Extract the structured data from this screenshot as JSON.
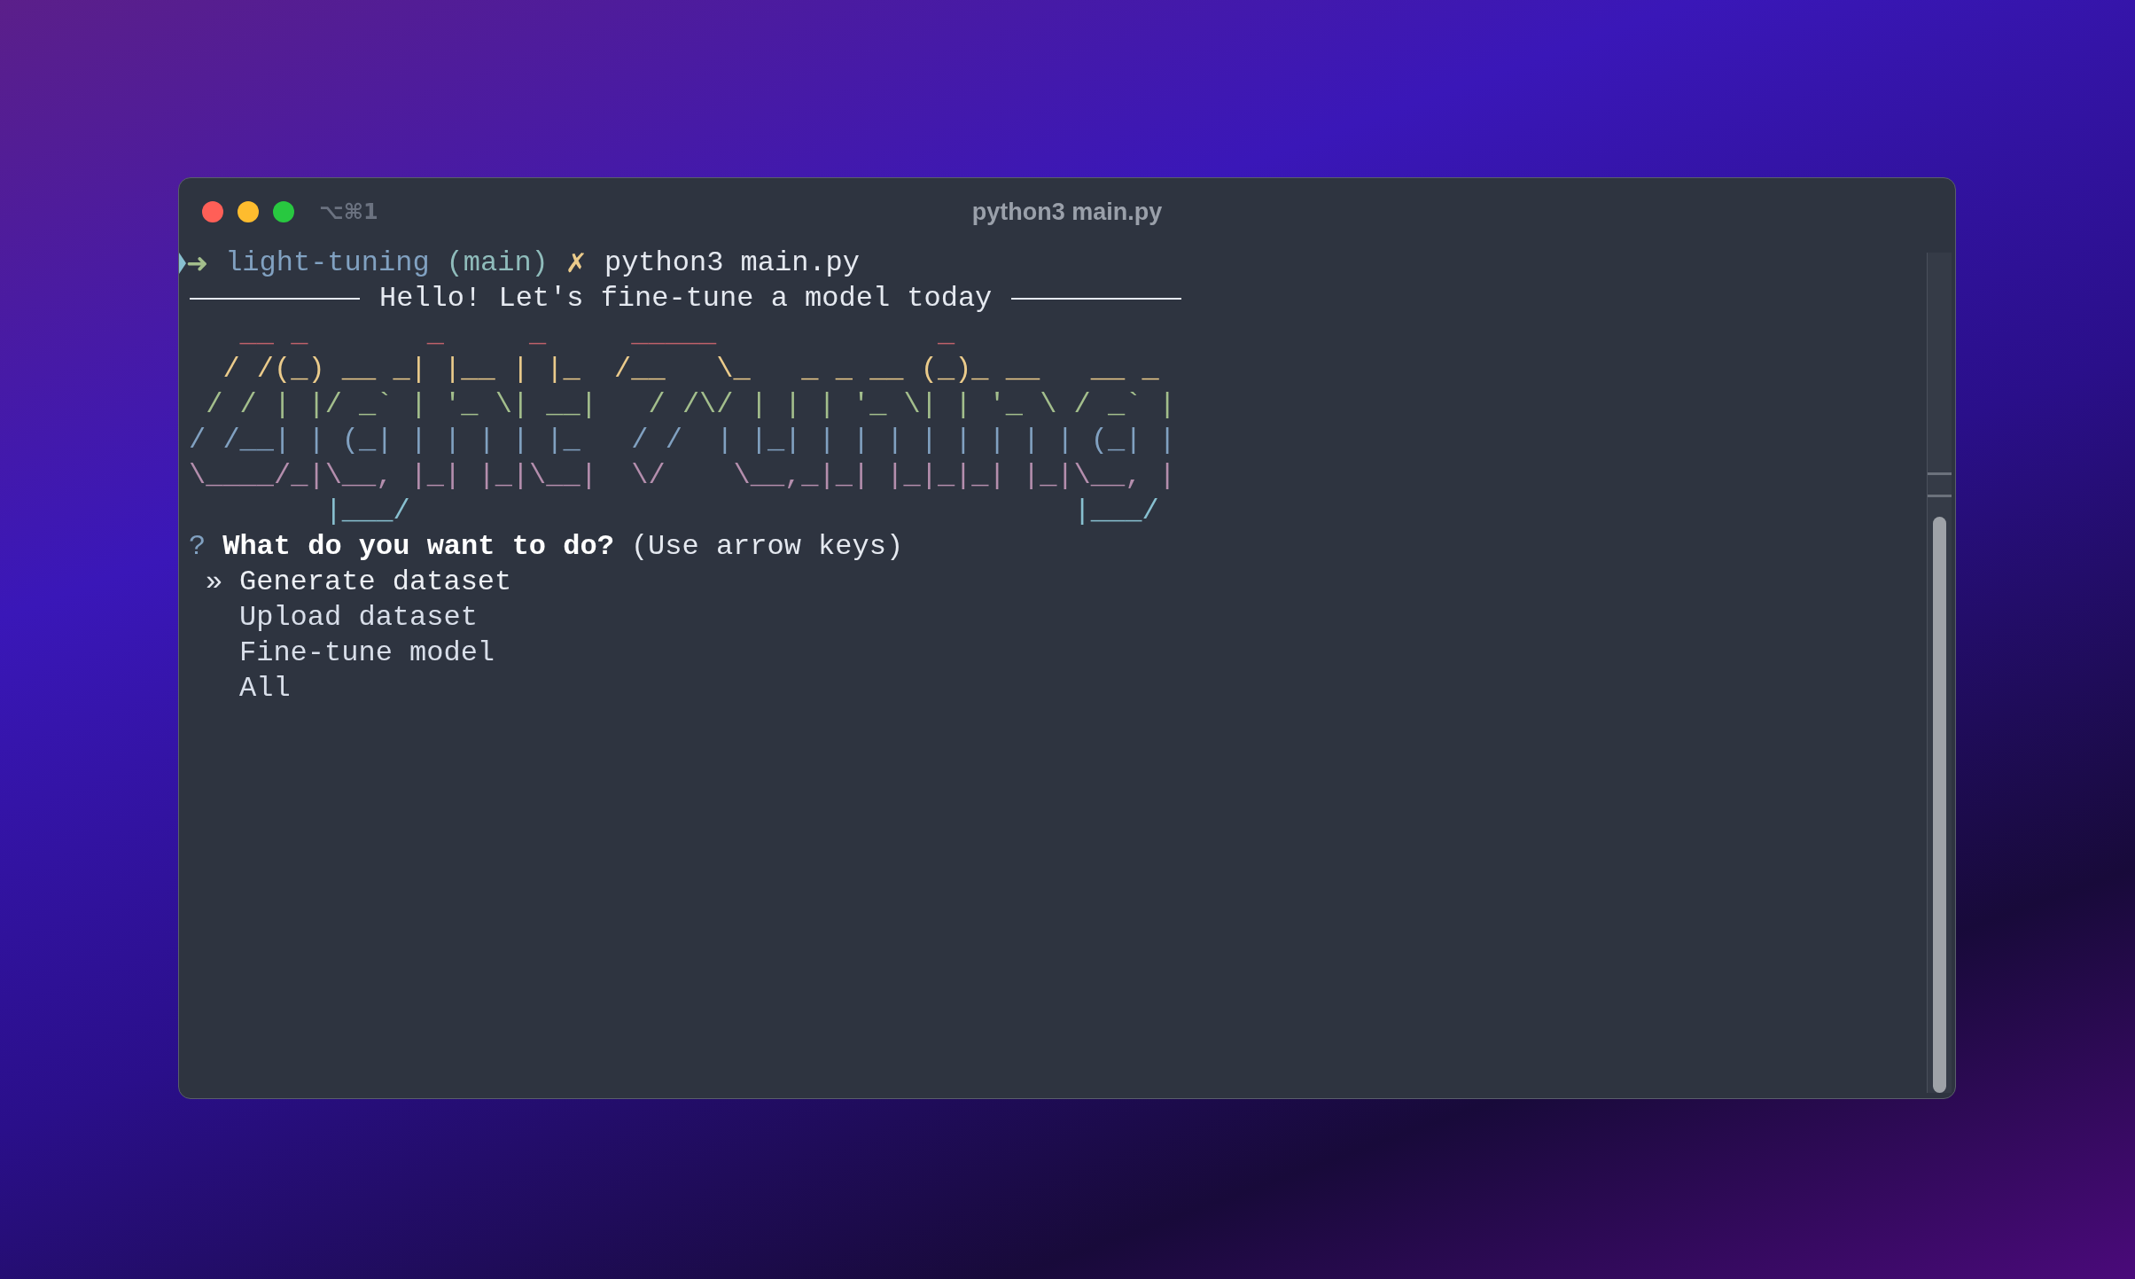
{
  "window": {
    "shortcut": "⌥⌘1",
    "title": "python3 main.py"
  },
  "prompt": {
    "arrow": "➜",
    "directory": "light-tuning",
    "branch": "(main)",
    "dirty_mark": "✗",
    "command": "python3 main.py"
  },
  "banner": {
    "text": "Hello! Let's fine-tune a model today"
  },
  "ascii_art": [
    {
      "text": "   __ _       _     _     _____             _",
      "color": "#bf616a"
    },
    {
      "text": "  / /(_) __ _| |__ | |_  /__   \\_   _ _ __ (_)_ __   __ _",
      "color": "#ebcb8b"
    },
    {
      "text": " / / | |/ _` | '_ \\| __|   / /\\/ | | | '_ \\| | '_ \\ / _` |",
      "color": "#a3be8c"
    },
    {
      "text": "/ /__| | (_| | | | | |_   / /  | |_| | | | | | | | | (_| |",
      "color": "#81a1c1"
    },
    {
      "text": "\\____/_|\\__, |_| |_|\\__|  \\/    \\__,_|_| |_|_|_| |_|\\__, |",
      "color": "#b48ead"
    },
    {
      "text": "        |___/                                       |___/",
      "color": "#88c0d0"
    }
  ],
  "question": {
    "mark": "?",
    "text": "What do you want to do?",
    "hint": "(Use arrow keys)"
  },
  "choices": {
    "pointer": "»",
    "items": [
      {
        "label": "Generate dataset",
        "selected": true
      },
      {
        "label": "Upload dataset",
        "selected": false
      },
      {
        "label": "Fine-tune model",
        "selected": false
      },
      {
        "label": "All",
        "selected": false
      }
    ]
  }
}
